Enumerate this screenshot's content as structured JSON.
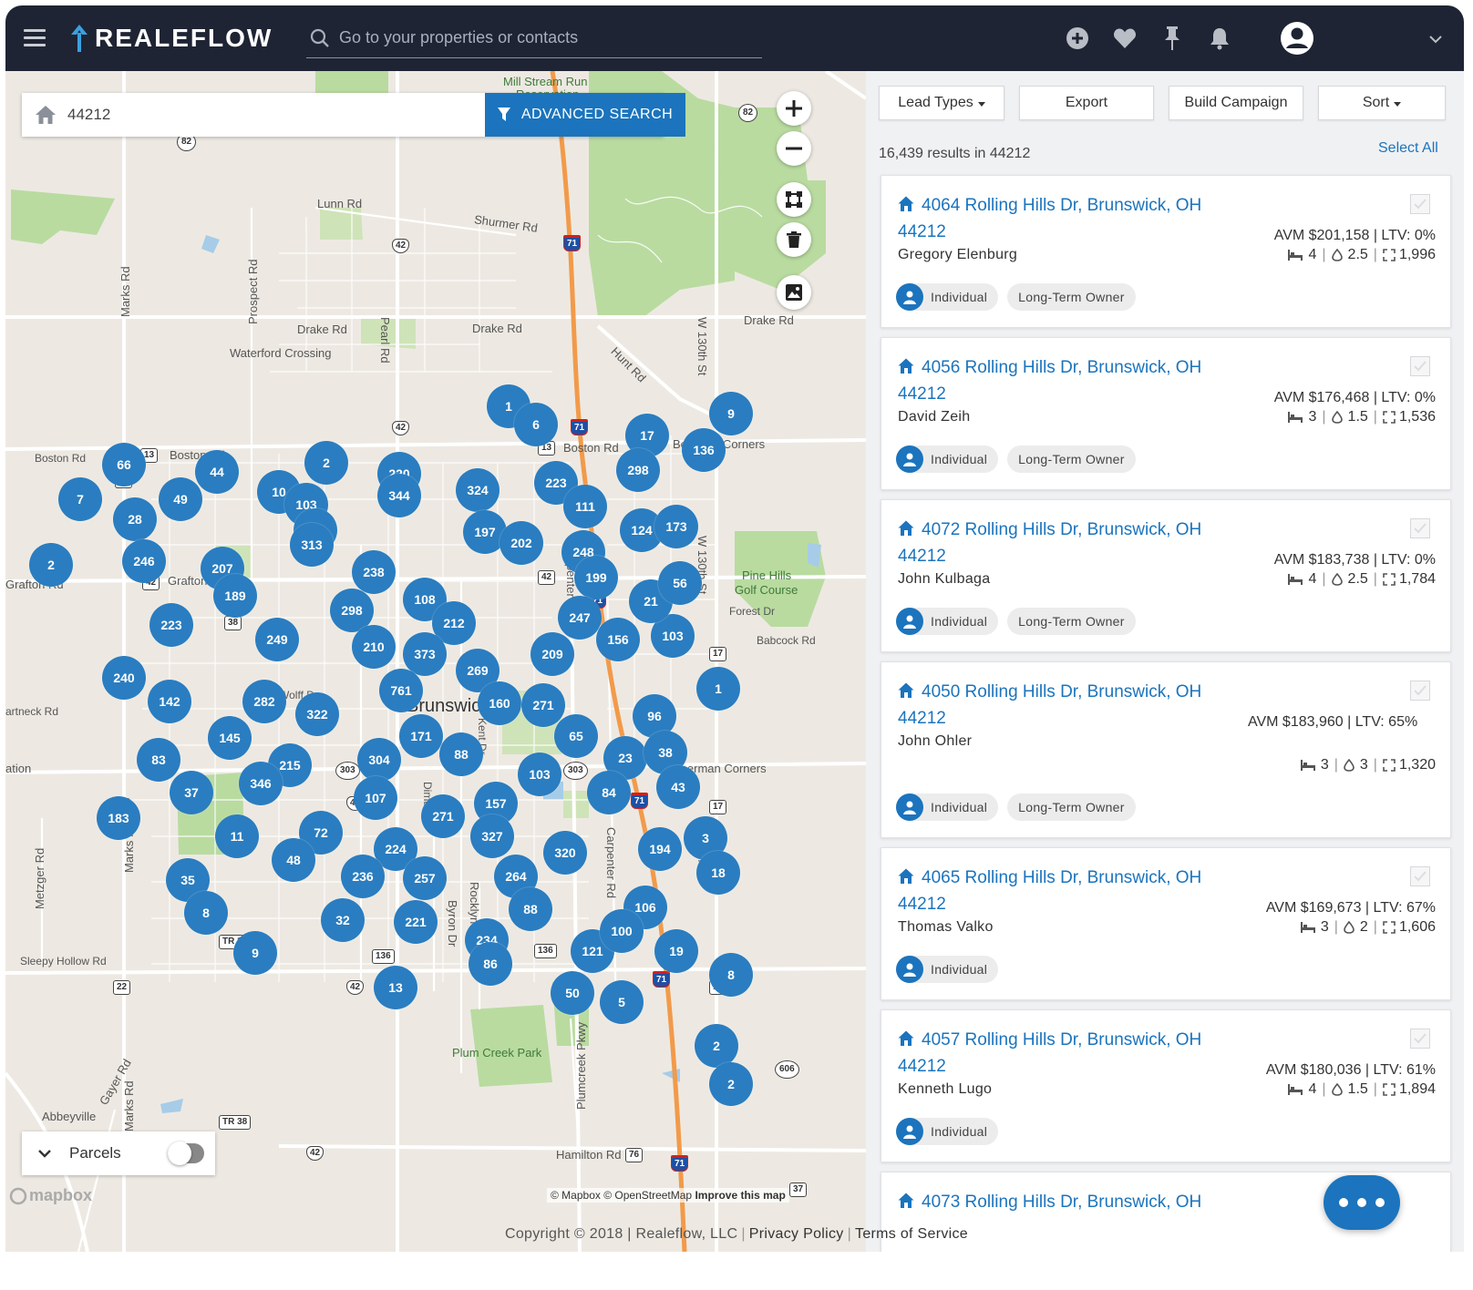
{
  "header": {
    "brand": "REALEFLOW",
    "search_placeholder": "Go to your properties or contacts",
    "icons": [
      "add-circle-icon",
      "heart-icon",
      "pin-icon",
      "bell-icon",
      "user-avatar-icon",
      "chevron-down-icon"
    ]
  },
  "map": {
    "search_value": "44212",
    "advanced_search_label": "ADVANCED SEARCH",
    "parcels_label": "Parcels",
    "parcels_toggle_on": false,
    "attribution": {
      "mapbox": "© Mapbox",
      "osm": "© OpenStreetMap",
      "improve": "Improve this map"
    },
    "logo": "mapbox",
    "place_labels": [
      {
        "text": "Mill Stream Run",
        "kind": "green"
      },
      {
        "text": "Reservation",
        "kind": "green"
      },
      {
        "text": "Lunn Rd"
      },
      {
        "text": "Shurmer Rd"
      },
      {
        "text": "Marks Rd"
      },
      {
        "text": "Prospect Rd"
      },
      {
        "text": "Pearl Rd"
      },
      {
        "text": "Drake Rd"
      },
      {
        "text": "Waterford Crossing"
      },
      {
        "text": "Hunt Rd"
      },
      {
        "text": "W 130th St"
      },
      {
        "text": "Boston Rd"
      },
      {
        "text": "Bennetts Corners"
      },
      {
        "text": "Grafton Rd"
      },
      {
        "text": "Pine Hills"
      },
      {
        "text": "Golf Course"
      },
      {
        "text": "Forest Dr"
      },
      {
        "text": "Babcock Rd"
      },
      {
        "text": "Brunswick"
      },
      {
        "text": "Sherman Corners"
      },
      {
        "text": "Metzger Rd"
      },
      {
        "text": "Sleepy Hollow Rd"
      },
      {
        "text": "Plum Creek Park"
      },
      {
        "text": "Plumcreek Pkwy"
      },
      {
        "text": "Abbeyville"
      },
      {
        "text": "Gayer Rd"
      },
      {
        "text": "Hamilton Rd"
      },
      {
        "text": "Carpenter Rd"
      },
      {
        "text": "Rocklyn Dr"
      },
      {
        "text": "Byron Dr"
      },
      {
        "text": "Kent Dr"
      },
      {
        "text": "Wolff Dr"
      },
      {
        "text": "Dima Dr"
      },
      {
        "text": "artneck Rd"
      },
      {
        "text": "ation"
      }
    ],
    "shields": [
      "82",
      "82",
      "42",
      "71",
      "42",
      "71",
      "13",
      "13",
      "22",
      "42",
      "42",
      "71",
      "17",
      "38",
      "22",
      "303",
      "303",
      "303",
      "17",
      "17",
      "42",
      "22",
      "TR 38",
      "136",
      "136",
      "42",
      "71",
      "17",
      "606",
      "TR 38",
      "42",
      "76",
      "71",
      "37",
      "17"
    ],
    "clusters": [
      "1",
      "6",
      "9",
      "17",
      "136",
      "66",
      "44",
      "2",
      "220",
      "344",
      "324",
      "223",
      "298",
      "7",
      "49",
      "10",
      "103",
      "30",
      "313",
      "28",
      "2",
      "246",
      "207",
      "189",
      "223",
      "197",
      "202",
      "111",
      "124",
      "173",
      "248",
      "199",
      "238",
      "108",
      "298",
      "212",
      "247",
      "156",
      "103",
      "249",
      "210",
      "373",
      "269",
      "209",
      "240",
      "142",
      "282",
      "322",
      "761",
      "160",
      "271",
      "1",
      "145",
      "171",
      "96",
      "83",
      "215",
      "304",
      "88",
      "65",
      "23",
      "38",
      "37",
      "346",
      "103",
      "84",
      "43",
      "183",
      "11",
      "72",
      "107",
      "271",
      "157",
      "3",
      "48",
      "224",
      "327",
      "320",
      "194",
      "35",
      "236",
      "257",
      "264",
      "18",
      "8",
      "32",
      "221",
      "88",
      "106",
      "9",
      "234",
      "121",
      "100",
      "19",
      "86",
      "13",
      "50",
      "5",
      "8",
      "2",
      "2",
      "21",
      "56",
      "124"
    ]
  },
  "panel": {
    "buttons": {
      "lead_types": "Lead Types",
      "export": "Export",
      "build_campaign": "Build Campaign",
      "sort": "Sort"
    },
    "results_text": "16,439 results in 44212",
    "select_all": "Select All",
    "listings": [
      {
        "address": "4064 Rolling Hills Dr, Brunswick, OH 44212",
        "owner": "Gregory Elenburg",
        "avm": "AVM $201,158 | LTV: 0%",
        "beds": "4",
        "baths": "2.5",
        "sqft": "1,996",
        "tags": [
          "Individual",
          "Long-Term Owner"
        ]
      },
      {
        "address": "4056 Rolling Hills Dr, Brunswick, OH 44212",
        "owner": "David Zeih",
        "avm": "AVM $176,468 | LTV: 0%",
        "beds": "3",
        "baths": "1.5",
        "sqft": "1,536",
        "tags": [
          "Individual",
          "Long-Term Owner"
        ]
      },
      {
        "address": "4072 Rolling Hills Dr, Brunswick, OH 44212",
        "owner": "John Kulbaga",
        "avm": "AVM $183,738 | LTV: 0%",
        "beds": "4",
        "baths": "2.5",
        "sqft": "1,784",
        "tags": [
          "Individual",
          "Long-Term Owner"
        ]
      },
      {
        "address": "4050 Rolling Hills Dr, Brunswick, OH 44212",
        "owner": "John Ohler",
        "avm": "AVM $183,960 | LTV: 65%",
        "beds": "3",
        "baths": "3",
        "sqft": "1,320",
        "tags": [
          "Individual",
          "Long-Term Owner"
        ]
      },
      {
        "address": "4065 Rolling Hills Dr, Brunswick, OH 44212",
        "owner": "Thomas Valko",
        "avm": "AVM $169,673 | LTV: 67%",
        "beds": "3",
        "baths": "2",
        "sqft": "1,606",
        "tags": [
          "Individual"
        ]
      },
      {
        "address": "4057 Rolling Hills Dr, Brunswick, OH 44212",
        "owner": "Kenneth Lugo",
        "avm": "AVM $180,036 | LTV: 61%",
        "beds": "4",
        "baths": "1.5",
        "sqft": "1,894",
        "tags": [
          "Individual"
        ]
      },
      {
        "address": "4073 Rolling Hills Dr, Brunswick, OH"
      }
    ]
  },
  "footer": {
    "copyright": "Copyright © 2018 | Realeflow, LLC",
    "privacy": "Privacy Policy",
    "terms": "Terms of Service"
  },
  "colors": {
    "topbar": "#1e2433",
    "accent": "#1b74bd",
    "cluster": "#2a7dc0",
    "interstate": "#f29a4a",
    "park": "#b9dba0"
  }
}
